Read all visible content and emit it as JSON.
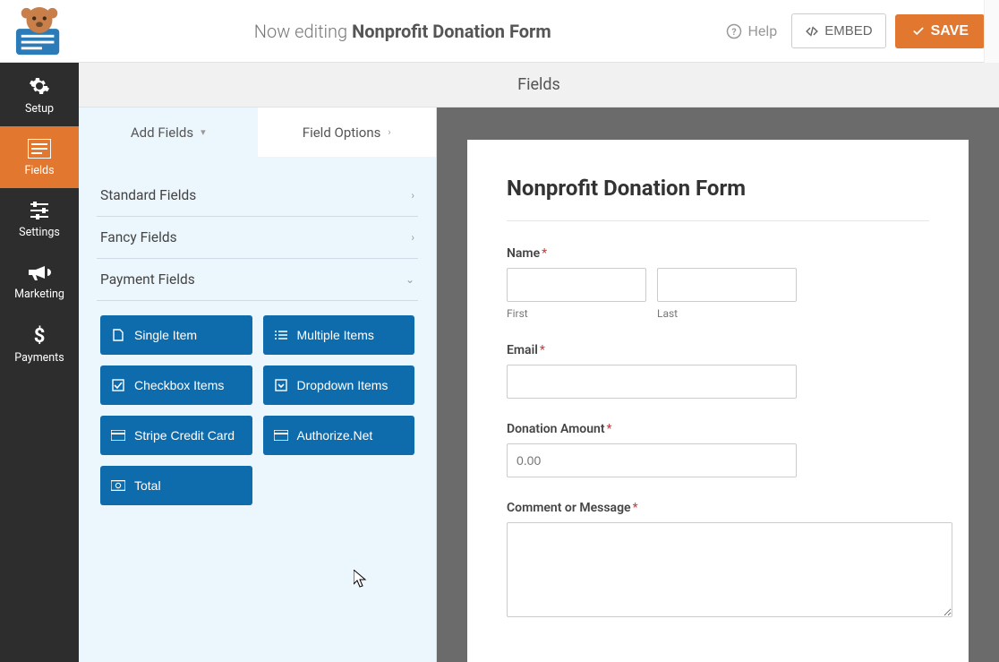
{
  "topbar": {
    "editing_prefix": "Now editing",
    "form_name": "Nonprofit Donation Form",
    "help": "Help",
    "embed": "EMBED",
    "save": "SAVE"
  },
  "leftnav": {
    "items": [
      {
        "label": "Setup"
      },
      {
        "label": "Fields"
      },
      {
        "label": "Settings"
      },
      {
        "label": "Marketing"
      },
      {
        "label": "Payments"
      }
    ],
    "active_index": 1
  },
  "section_header": "Fields",
  "tabs": {
    "add_fields": "Add Fields",
    "field_options": "Field Options",
    "active": "add_fields"
  },
  "accordion": {
    "standard": "Standard Fields",
    "fancy": "Fancy Fields",
    "payment": "Payment Fields",
    "expanded": "payment"
  },
  "payment_fields": [
    {
      "label": "Single Item",
      "icon": "file"
    },
    {
      "label": "Multiple Items",
      "icon": "list"
    },
    {
      "label": "Checkbox Items",
      "icon": "check-square"
    },
    {
      "label": "Dropdown Items",
      "icon": "caret-down-square"
    },
    {
      "label": "Stripe Credit Card",
      "icon": "card"
    },
    {
      "label": "Authorize.Net",
      "icon": "card"
    },
    {
      "label": "Total",
      "icon": "money"
    }
  ],
  "preview": {
    "title": "Nonprofit Donation Form",
    "fields": {
      "name": {
        "label": "Name",
        "required": true,
        "sub_first": "First",
        "sub_last": "Last"
      },
      "email": {
        "label": "Email",
        "required": true
      },
      "donation": {
        "label": "Donation Amount",
        "required": true,
        "placeholder": "0.00"
      },
      "comment": {
        "label": "Comment or Message",
        "required": true
      }
    }
  },
  "colors": {
    "accent_orange": "#e27730",
    "button_blue": "#0e6cad",
    "panel_blue": "#ecf6fd"
  }
}
